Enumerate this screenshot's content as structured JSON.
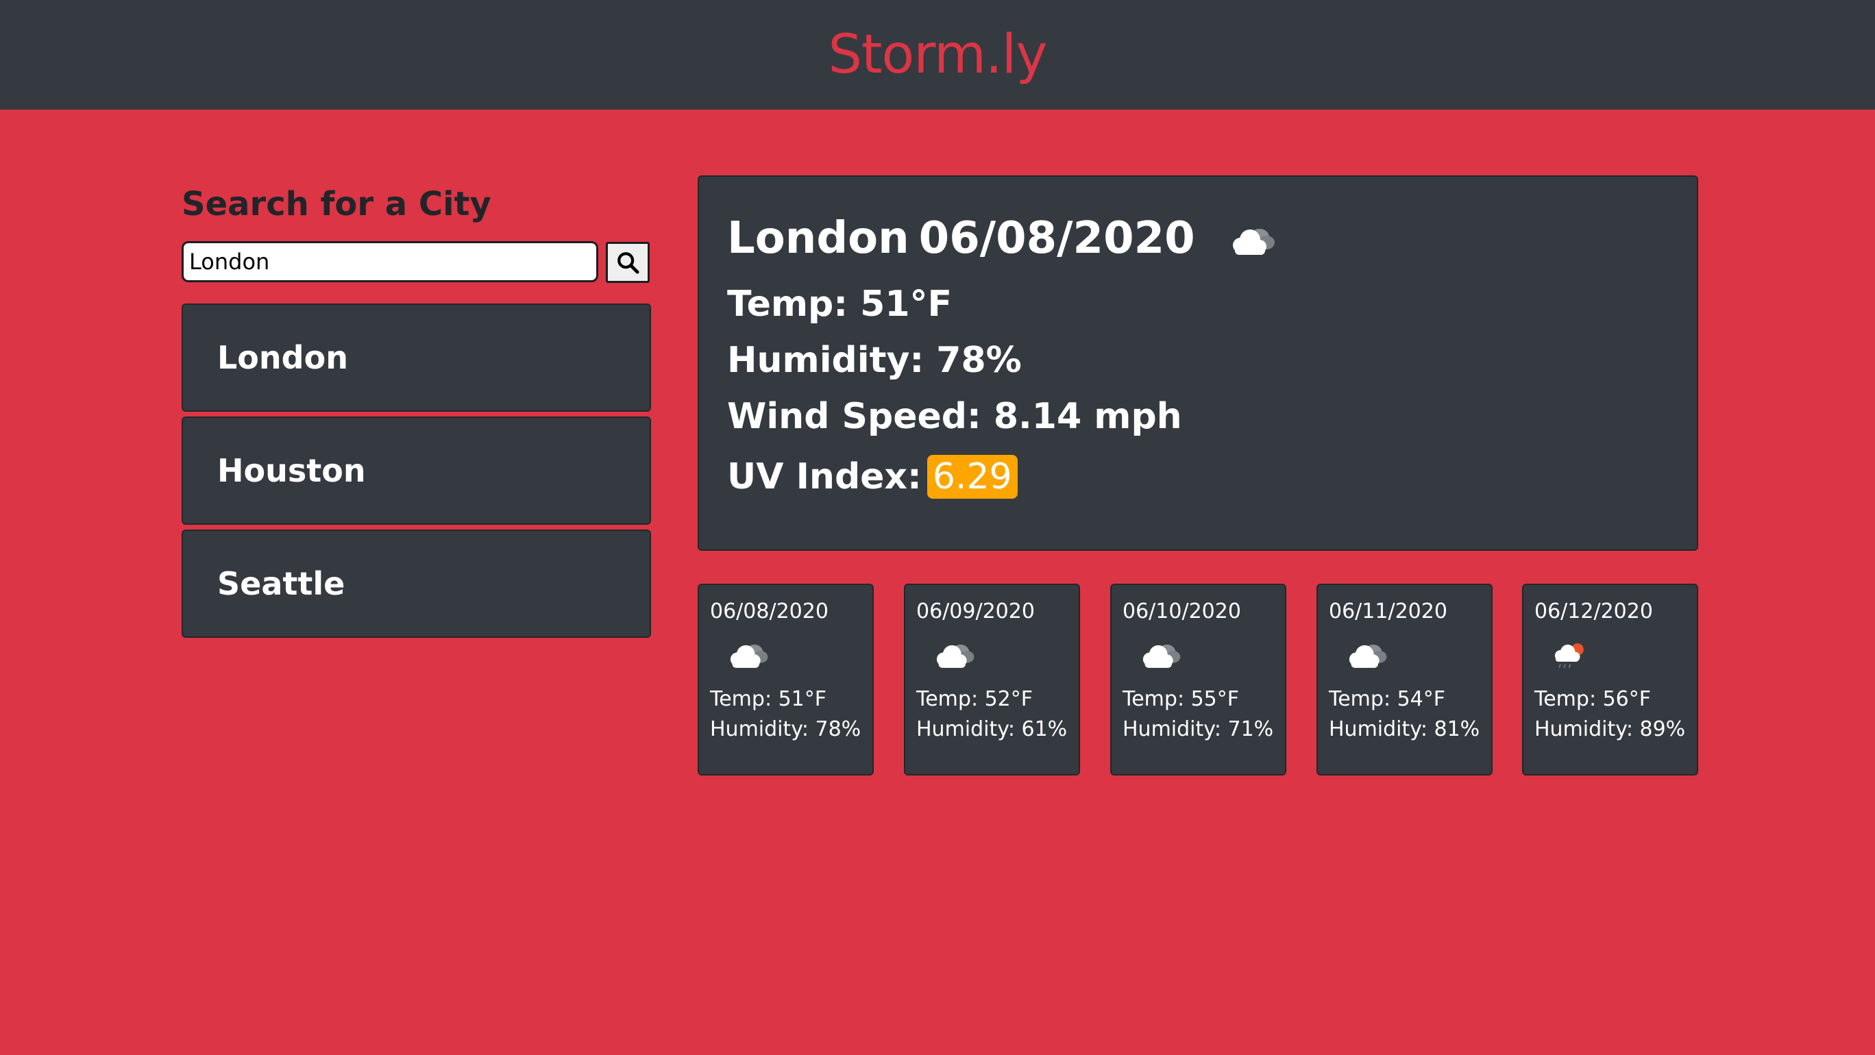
{
  "app": {
    "title": "Storm.ly",
    "brand_color": "#dc3545",
    "background_color": "#dc3545",
    "navbar_color": "#343a40"
  },
  "search": {
    "heading": "Search for a City",
    "value": "London",
    "button_icon": "search-icon"
  },
  "history": {
    "cities": [
      "London",
      "Houston",
      "Seattle"
    ]
  },
  "current": {
    "city": "London",
    "date": "06/08/2020",
    "icon": "cloud-icon",
    "temp_label": "Temp:",
    "temp": "51°F",
    "humidity_label": "Humidity:",
    "humidity": "78%",
    "wind_label": "Wind Speed:",
    "wind": "8.14 mph",
    "uv_label": "UV Index:",
    "uv": "6.29",
    "uv_color": "#ffa500"
  },
  "forecast": [
    {
      "date": "06/08/2020",
      "icon": "cloud-icon",
      "temp": "Temp: 51°F",
      "humidity": "Humidity: 78%"
    },
    {
      "date": "06/09/2020",
      "icon": "cloud-icon",
      "temp": "Temp: 52°F",
      "humidity": "Humidity: 61%"
    },
    {
      "date": "06/10/2020",
      "icon": "cloud-icon",
      "temp": "Temp: 55°F",
      "humidity": "Humidity: 71%"
    },
    {
      "date": "06/11/2020",
      "icon": "cloud-icon",
      "temp": "Temp: 54°F",
      "humidity": "Humidity: 81%"
    },
    {
      "date": "06/12/2020",
      "icon": "rain-sun-icon",
      "temp": "Temp: 56°F",
      "humidity": "Humidity: 89%"
    }
  ]
}
